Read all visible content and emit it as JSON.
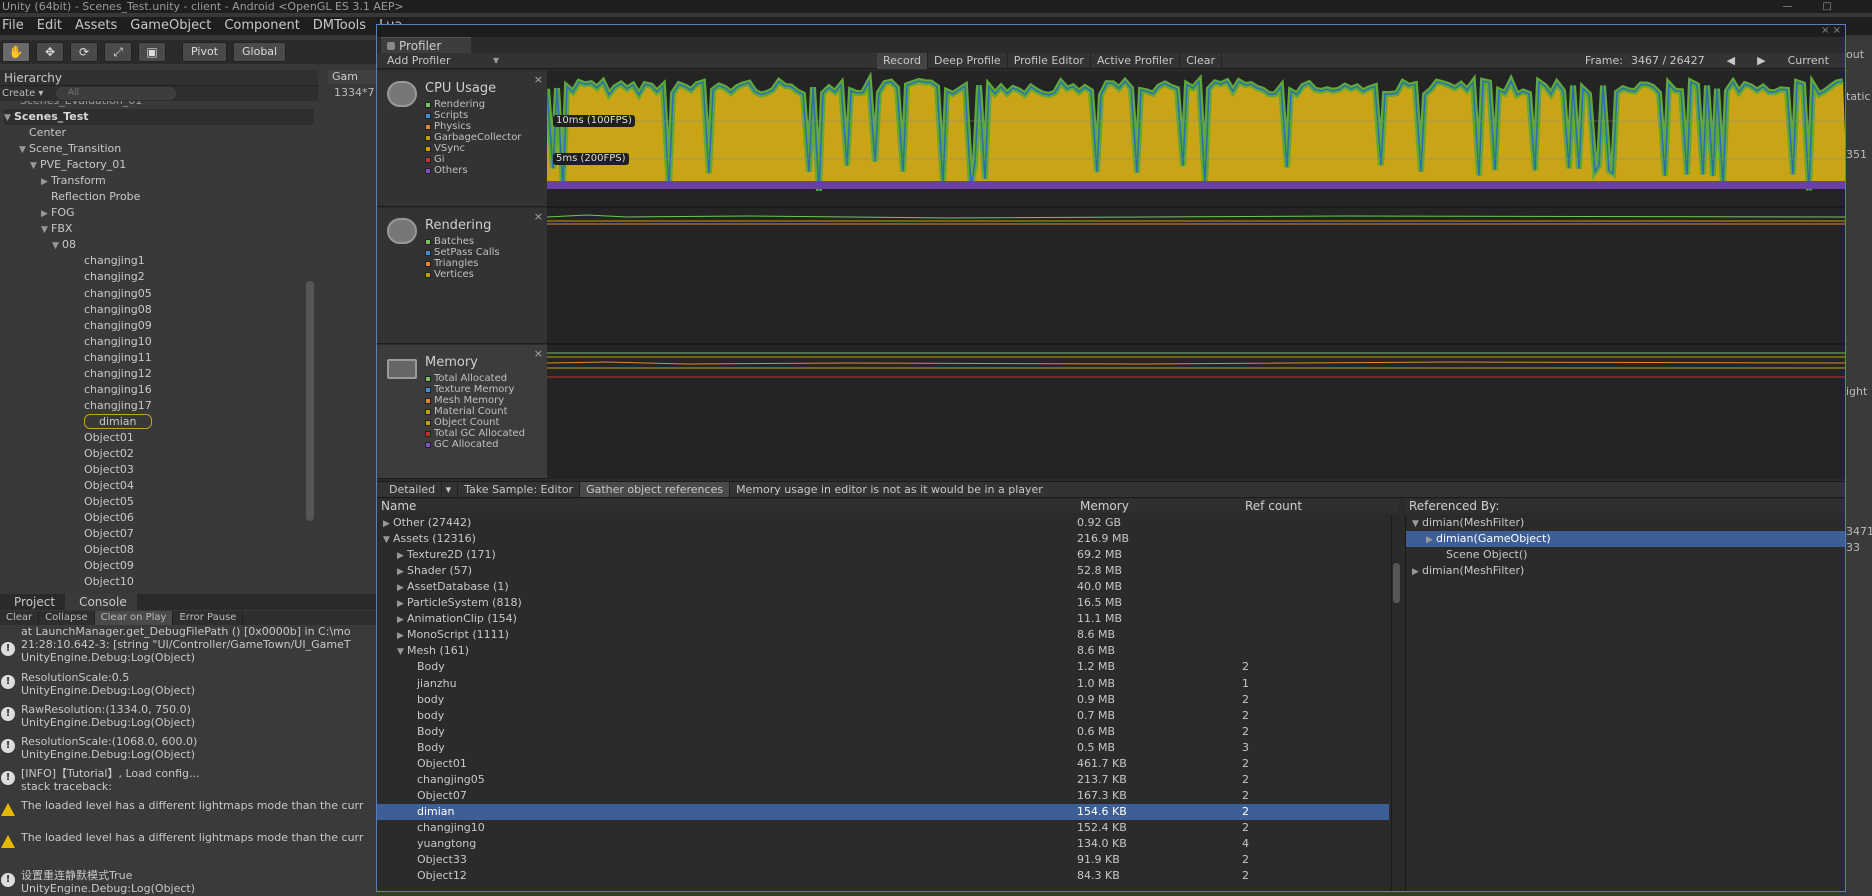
{
  "window": {
    "title": "Unity (64bit) - Scenes_Test.unity - client - Android <OpenGL ES 3.1 AEP>",
    "minimize": "—",
    "maximize": "□"
  },
  "menu": [
    "File",
    "Edit",
    "Assets",
    "GameObject",
    "Component",
    "DMTools",
    "Lua"
  ],
  "toolbar": {
    "tools": [
      "hand-icon",
      "move-icon",
      "rotate-icon",
      "scale-icon",
      "rect-icon"
    ],
    "pivot": "Pivot",
    "global": "Global"
  },
  "hierarchy": {
    "tab": "Hierarchy",
    "create": "Create",
    "search_placeholder": "All",
    "top_clipped": "Scenes_Evaluation_01",
    "scene": "Scenes_Test",
    "items": [
      {
        "label": "Center",
        "indent": 1,
        "tri": ""
      },
      {
        "label": "Scene_Transition",
        "indent": 1,
        "tri": "▼"
      },
      {
        "label": "PVE_Factory_01",
        "indent": 2,
        "tri": "▼"
      },
      {
        "label": "Transform",
        "indent": 3,
        "tri": "▶"
      },
      {
        "label": "Reflection Probe",
        "indent": 3,
        "tri": ""
      },
      {
        "label": "FOG",
        "indent": 3,
        "tri": "▶"
      },
      {
        "label": "FBX",
        "indent": 3,
        "tri": "▼"
      },
      {
        "label": "08",
        "indent": 4,
        "tri": "▼"
      },
      {
        "label": "changjing1",
        "indent": 6,
        "tri": ""
      },
      {
        "label": "changjing2",
        "indent": 6,
        "tri": ""
      },
      {
        "label": "changjing05",
        "indent": 6,
        "tri": ""
      },
      {
        "label": "changjing08",
        "indent": 6,
        "tri": ""
      },
      {
        "label": "changjing09",
        "indent": 6,
        "tri": ""
      },
      {
        "label": "changjing10",
        "indent": 6,
        "tri": ""
      },
      {
        "label": "changjing11",
        "indent": 6,
        "tri": ""
      },
      {
        "label": "changjing12",
        "indent": 6,
        "tri": ""
      },
      {
        "label": "changjing16",
        "indent": 6,
        "tri": ""
      },
      {
        "label": "changjing17",
        "indent": 6,
        "tri": ""
      },
      {
        "label": "dimian",
        "indent": 6,
        "tri": "",
        "selected": true
      },
      {
        "label": "Object01",
        "indent": 6,
        "tri": ""
      },
      {
        "label": "Object02",
        "indent": 6,
        "tri": ""
      },
      {
        "label": "Object03",
        "indent": 6,
        "tri": ""
      },
      {
        "label": "Object04",
        "indent": 6,
        "tri": ""
      },
      {
        "label": "Object05",
        "indent": 6,
        "tri": ""
      },
      {
        "label": "Object06",
        "indent": 6,
        "tri": ""
      },
      {
        "label": "Object07",
        "indent": 6,
        "tri": ""
      },
      {
        "label": "Object08",
        "indent": 6,
        "tri": ""
      },
      {
        "label": "Object09",
        "indent": 6,
        "tri": ""
      },
      {
        "label": "Object10",
        "indent": 6,
        "tri": ""
      }
    ]
  },
  "game": {
    "tab": "Gam",
    "resolution": "1334*7"
  },
  "console": {
    "tabs": [
      "Project",
      "Console"
    ],
    "tools": [
      "Clear",
      "Collapse",
      "Clear on Play",
      "Error Pause"
    ],
    "top_clipped": "at LaunchManager.get_DebugFilePath () [0x0000b] in C:\\mo",
    "logs": [
      {
        "type": "info",
        "line1": "21:28:10.642-3: [string \"UI/Controller/GameTown/UI_GameT",
        "line2": "UnityEngine.Debug:Log(Object)"
      },
      {
        "type": "info",
        "line1": "ResolutionScale:0.5",
        "line2": "UnityEngine.Debug:Log(Object)"
      },
      {
        "type": "info",
        "line1": "RawResolution:(1334.0, 750.0)",
        "line2": "UnityEngine.Debug:Log(Object)"
      },
      {
        "type": "info",
        "line1": "ResolutionScale:(1068.0, 600.0)",
        "line2": "UnityEngine.Debug:Log(Object)"
      },
      {
        "type": "info",
        "line1": "[INFO]【Tutorial】, Load config...",
        "line2": "stack traceback:"
      },
      {
        "type": "warn",
        "line1": "The loaded level has a different lightmaps mode than the curr",
        "line2": ""
      },
      {
        "type": "warn",
        "line1": "The loaded level has a different lightmaps mode than the curr",
        "line2": ""
      },
      {
        "type": "info",
        "line1": "设置重连静默模式True",
        "line2": "UnityEngine.Debug:Log(Object)"
      }
    ]
  },
  "right_sliver": {
    "a": "out",
    "b": "tatic",
    "c": "351",
    "d": "ight",
    "e": "3471",
    "f": "33"
  },
  "profiler": {
    "tab": "Profiler",
    "add_profiler": "Add Profiler",
    "buttons": [
      "Record",
      "Deep Profile",
      "Profile Editor",
      "Active Profiler",
      "Clear"
    ],
    "frame_label": "Frame:",
    "frame_value": "3467 / 26427",
    "prev": "◀",
    "next": "▶",
    "current": "Current",
    "modules": [
      {
        "title": "CPU Usage",
        "legend": [
          {
            "name": "Rendering",
            "color": "#78c060"
          },
          {
            "name": "Scripts",
            "color": "#3f8fd6"
          },
          {
            "name": "Physics",
            "color": "#e08830"
          },
          {
            "name": "GarbageCollector",
            "color": "#c0a000"
          },
          {
            "name": "VSync",
            "color": "#c8a000"
          },
          {
            "name": "Gi",
            "color": "#c03030"
          },
          {
            "name": "Others",
            "color": "#8050c0"
          }
        ]
      },
      {
        "title": "Rendering",
        "legend": [
          {
            "name": "Batches",
            "color": "#78c060"
          },
          {
            "name": "SetPass Calls",
            "color": "#3f8fd6"
          },
          {
            "name": "Triangles",
            "color": "#e08830"
          },
          {
            "name": "Vertices",
            "color": "#c0a000"
          }
        ]
      },
      {
        "title": "Memory",
        "legend": [
          {
            "name": "Total Allocated",
            "color": "#78c060"
          },
          {
            "name": "Texture Memory",
            "color": "#3f8fd6"
          },
          {
            "name": "Mesh Memory",
            "color": "#e08830"
          },
          {
            "name": "Material Count",
            "color": "#c0a000"
          },
          {
            "name": "Object Count",
            "color": "#c8a000"
          },
          {
            "name": "Total GC Allocated",
            "color": "#c03030"
          },
          {
            "name": "GC Allocated",
            "color": "#8050c0"
          }
        ]
      }
    ],
    "cpu_labels": [
      "10ms (100FPS)",
      "5ms (200FPS)"
    ],
    "detail_bar": [
      "Detailed",
      "Take Sample: Editor",
      "Gather object references",
      "Memory usage in editor is not as it would be in a player"
    ],
    "table_headers": [
      "Name",
      "Memory",
      "Ref count"
    ],
    "rows": [
      {
        "name": "Other (27442)",
        "mem": "0.92 GB",
        "ref": "",
        "indent": 0,
        "tri": "▶"
      },
      {
        "name": "Assets (12316)",
        "mem": "216.9 MB",
        "ref": "",
        "indent": 0,
        "tri": "▼"
      },
      {
        "name": "Texture2D (171)",
        "mem": "69.2 MB",
        "ref": "",
        "indent": 1,
        "tri": "▶"
      },
      {
        "name": "Shader (57)",
        "mem": "52.8 MB",
        "ref": "",
        "indent": 1,
        "tri": "▶"
      },
      {
        "name": "AssetDatabase (1)",
        "mem": "40.0 MB",
        "ref": "",
        "indent": 1,
        "tri": "▶"
      },
      {
        "name": "ParticleSystem (818)",
        "mem": "16.5 MB",
        "ref": "",
        "indent": 1,
        "tri": "▶"
      },
      {
        "name": "AnimationClip (154)",
        "mem": "11.1 MB",
        "ref": "",
        "indent": 1,
        "tri": "▶"
      },
      {
        "name": "MonoScript (1111)",
        "mem": "8.6 MB",
        "ref": "",
        "indent": 1,
        "tri": "▶"
      },
      {
        "name": "Mesh (161)",
        "mem": "8.6 MB",
        "ref": "",
        "indent": 1,
        "tri": "▼"
      },
      {
        "name": "Body",
        "mem": "1.2 MB",
        "ref": "2",
        "indent": 2,
        "tri": ""
      },
      {
        "name": "jianzhu",
        "mem": "1.0 MB",
        "ref": "1",
        "indent": 2,
        "tri": ""
      },
      {
        "name": "body",
        "mem": "0.9 MB",
        "ref": "2",
        "indent": 2,
        "tri": ""
      },
      {
        "name": "body",
        "mem": "0.7 MB",
        "ref": "2",
        "indent": 2,
        "tri": ""
      },
      {
        "name": "Body",
        "mem": "0.6 MB",
        "ref": "2",
        "indent": 2,
        "tri": ""
      },
      {
        "name": "Body",
        "mem": "0.5 MB",
        "ref": "3",
        "indent": 2,
        "tri": ""
      },
      {
        "name": "Object01",
        "mem": "461.7 KB",
        "ref": "2",
        "indent": 2,
        "tri": ""
      },
      {
        "name": "changjing05",
        "mem": "213.7 KB",
        "ref": "2",
        "indent": 2,
        "tri": ""
      },
      {
        "name": "Object07",
        "mem": "167.3 KB",
        "ref": "2",
        "indent": 2,
        "tri": ""
      },
      {
        "name": "dimian",
        "mem": "154.6 KB",
        "ref": "2",
        "indent": 2,
        "tri": "",
        "selected": true
      },
      {
        "name": "changjing10",
        "mem": "152.4 KB",
        "ref": "2",
        "indent": 2,
        "tri": ""
      },
      {
        "name": "yuangtong",
        "mem": "134.0 KB",
        "ref": "4",
        "indent": 2,
        "tri": ""
      },
      {
        "name": "Object33",
        "mem": "91.9 KB",
        "ref": "2",
        "indent": 2,
        "tri": ""
      },
      {
        "name": "Object12",
        "mem": "84.3 KB",
        "ref": "2",
        "indent": 2,
        "tri": ""
      }
    ],
    "referenced_by": "Referenced By:",
    "refs": [
      {
        "name": "dimian(MeshFilter)",
        "indent": 0,
        "tri": "▼"
      },
      {
        "name": "dimian(GameObject)",
        "indent": 1,
        "tri": "▶",
        "selected": true
      },
      {
        "name": "Scene Object()",
        "indent": 2,
        "tri": ""
      },
      {
        "name": "dimian(MeshFilter)",
        "indent": 0,
        "tri": "▶"
      }
    ]
  }
}
